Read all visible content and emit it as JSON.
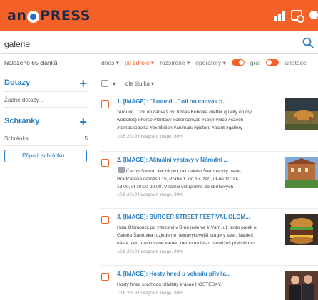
{
  "app": {
    "logo_text_left": "an",
    "logo_text_right": "PRESS",
    "brand_color": "#f4622a",
    "accent_color": "#2b80c4",
    "top_icons": [
      "stats-icon",
      "notification-icon",
      "user-icon"
    ]
  },
  "search": {
    "value": "galerie",
    "icon": "search-icon"
  },
  "filters": {
    "found": "Nalezeno 65 článků",
    "date": "dnes ▾",
    "sources": "[x] zdroje ▾",
    "extended": "rozšířené ▾",
    "operators": "operátory ▾",
    "graph": "graf",
    "annotation": "anotace",
    "graph_toggle_on": true,
    "annotation_toggle_on": true
  },
  "sidebar": {
    "queries_heading": "Dotazy",
    "queries_empty": "Žádné dotazy...",
    "boxes_heading": "Schránky",
    "box_name": "Schránka",
    "box_count": "5",
    "connect_button": "Připojit schránku..."
  },
  "sort": {
    "label": "dle titulku ▾"
  },
  "results": [
    {
      "title": "1. [IMAGE]: \"Around...\" oil on canvas b...",
      "snippet_lines": [
        "\"Around...\" oil on canvas by Tomas Kobolka (better quality on my",
        "websites) #horse #fantasy #oiloncanvas #color #nice #czech",
        "#tomaskobolka #exhibition #animals #picture #paint #gallery"
      ],
      "meta": "10.6.2019 Instagram image, 80%"
    },
    {
      "title": "2. [IMAGE]: Aktuální výstavy v Národní ...",
      "snippet_lines": [
        "Čechy-Sasko: Jak blízko, tak daleko   Šternberský palác,",
        "Hradčanské náměstí 15, Praha 1.   do 15. září, út-ne 10:00-",
        "18:00, st 10:00-20:00.   V rámci vstupného do sbírkových"
      ],
      "meta": "10.6.2019 Instagram image, 80%"
    },
    {
      "title": "3. [IMAGE]: BURGER STREET FESTIVAL OLOM...",
      "snippet_lines": [
        "Hola Olomouci, po vítězství v Brně jedeme k Vám, už tento pátek u",
        "Galerie Šantovka rozjedeme nejnávykovější burgery ever. Najdeš",
        "nás v naší maskované varně, kterou na festu nemůžeš přehlídnout."
      ],
      "meta": "10.6.2019 Instagram image, 80%"
    },
    {
      "title": "4. [IMAGE]: Hosty hned u vchodu přivíta...",
      "snippet_lines": [
        "Hosty hned u vchodu přivítaly krásné HOSTESKY."
      ],
      "meta": "10.6.2019 Instagram image, 80%"
    }
  ]
}
